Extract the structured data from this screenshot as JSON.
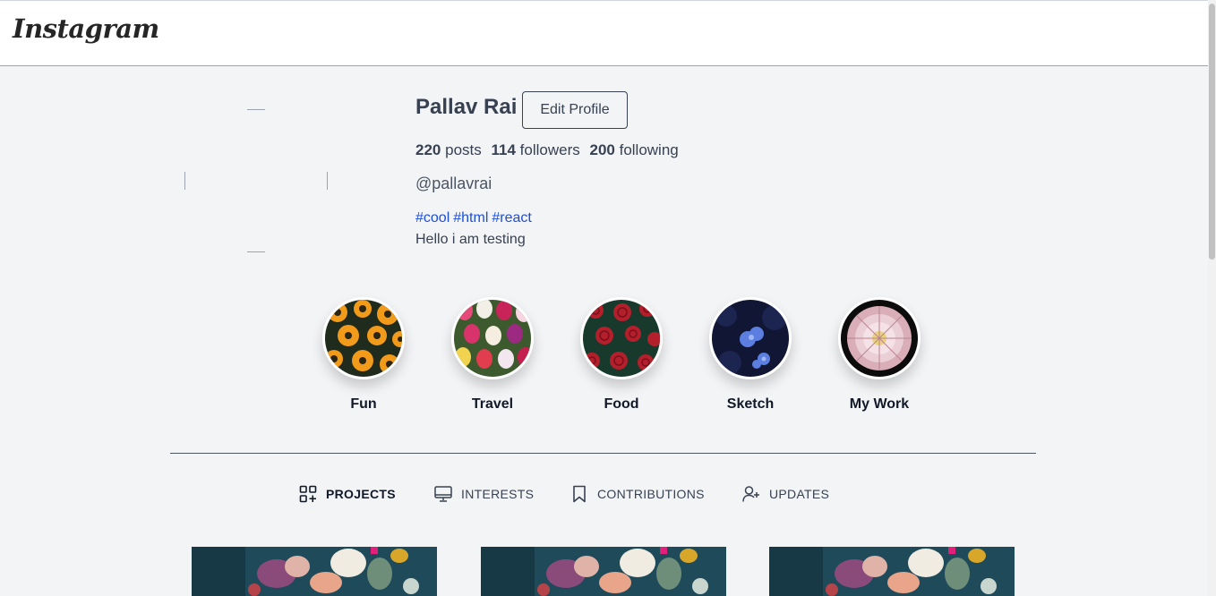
{
  "header": {
    "logo_text": "Instagram"
  },
  "profile": {
    "name": "Pallav Rai",
    "edit_button": "Edit Profile",
    "stats": [
      {
        "count": "220",
        "label": "posts"
      },
      {
        "count": "114",
        "label": "followers"
      },
      {
        "count": "200",
        "label": "following"
      }
    ],
    "handle": "@pallavrai",
    "tags": [
      "#cool",
      "#html",
      "#react"
    ],
    "bio": "Hello i am testing"
  },
  "highlights": [
    {
      "label": "Fun",
      "theme": "orange-daisies"
    },
    {
      "label": "Travel",
      "theme": "tulips"
    },
    {
      "label": "Food",
      "theme": "red-roses"
    },
    {
      "label": "Sketch",
      "theme": "blue-flowers"
    },
    {
      "label": "My Work",
      "theme": "pink-dahlia"
    }
  ],
  "tabs": [
    {
      "label": "PROJECTS",
      "icon": "grid-plus-icon",
      "active": true
    },
    {
      "label": "INTERESTS",
      "icon": "monitor-icon",
      "active": false
    },
    {
      "label": "CONTRIBUTIONS",
      "icon": "bookmark-icon",
      "active": false
    },
    {
      "label": "UPDATES",
      "icon": "user-plus-icon",
      "active": false
    }
  ],
  "posts": [
    {
      "theme": "flower-bouquet"
    },
    {
      "theme": "flower-bouquet"
    },
    {
      "theme": "flower-bouquet"
    }
  ],
  "colors": {
    "link": "#1d4ed8",
    "background": "#f3f4f6",
    "text": "#374151"
  }
}
